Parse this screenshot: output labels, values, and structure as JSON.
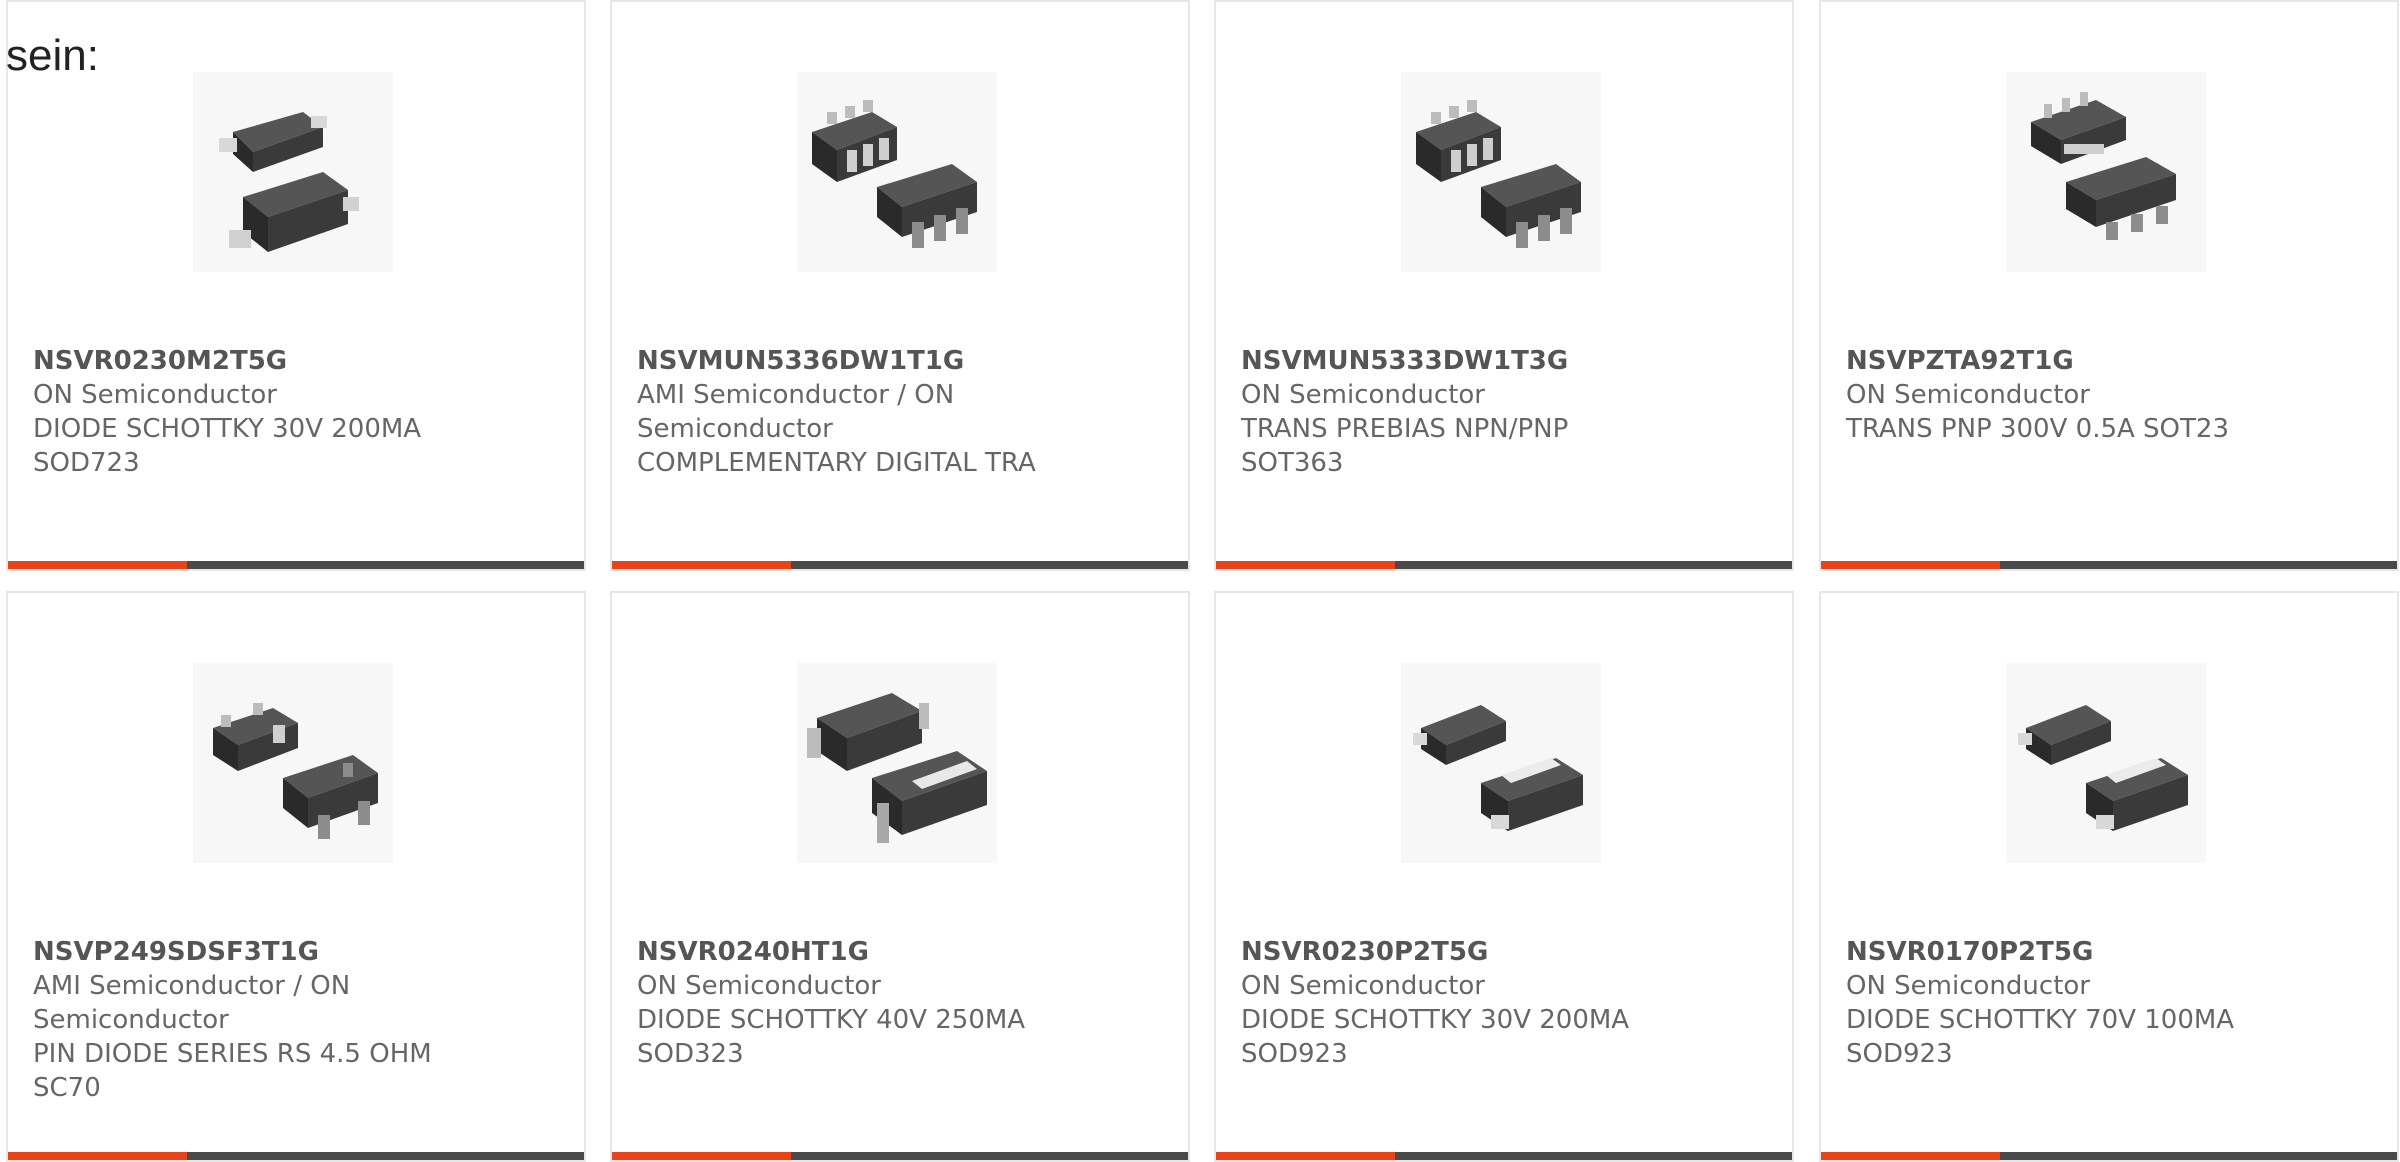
{
  "lead_text": "sein:",
  "accent_color": "#e8431b",
  "bar_color": "#4a4a4a",
  "products": [
    {
      "part": "NSVR0230M2T5G",
      "manufacturer": "ON Semiconductor",
      "desc1": "DIODE SCHOTTKY 30V 200MA",
      "desc2": "SOD723",
      "image": "sod723-package-image",
      "highlight_fraction": 0.31
    },
    {
      "part": "NSVMUN5336DW1T1G",
      "manufacturer": "AMI Semiconductor / ON",
      "manufacturer2": "Semiconductor",
      "desc1": "COMPLEMENTARY DIGITAL TRA",
      "image": "sot363-package-image",
      "highlight_fraction": 0.31
    },
    {
      "part": "NSVMUN5333DW1T3G",
      "manufacturer": "ON Semiconductor",
      "desc1": "TRANS PREBIAS NPN/PNP",
      "desc2": "SOT363",
      "image": "sot363-package-image",
      "highlight_fraction": 0.31
    },
    {
      "part": "NSVPZTA92T1G",
      "manufacturer": "ON Semiconductor",
      "desc1": "TRANS PNP 300V 0.5A SOT23",
      "image": "sot223-package-image",
      "highlight_fraction": 0.31
    },
    {
      "part": "NSVP249SDSF3T1G",
      "manufacturer": "AMI Semiconductor / ON",
      "manufacturer2": "Semiconductor",
      "desc1": "PIN DIODE SERIES RS 4.5 OHM",
      "desc2": "SC70",
      "image": "sc70-package-image",
      "highlight_fraction": 0.31
    },
    {
      "part": "NSVR0240HT1G",
      "manufacturer": "ON Semiconductor",
      "desc1": "DIODE SCHOTTKY 40V 250MA",
      "desc2": "SOD323",
      "image": "sod323-package-image",
      "highlight_fraction": 0.31
    },
    {
      "part": "NSVR0230P2T5G",
      "manufacturer": "ON Semiconductor",
      "desc1": "DIODE SCHOTTKY 30V 200MA",
      "desc2": "SOD923",
      "image": "sod923-package-image",
      "highlight_fraction": 0.31
    },
    {
      "part": "NSVR0170P2T5G",
      "manufacturer": "ON Semiconductor",
      "desc1": "DIODE SCHOTTKY 70V 100MA",
      "desc2": "SOD923",
      "image": "sod923-package-image",
      "highlight_fraction": 0.31
    }
  ]
}
